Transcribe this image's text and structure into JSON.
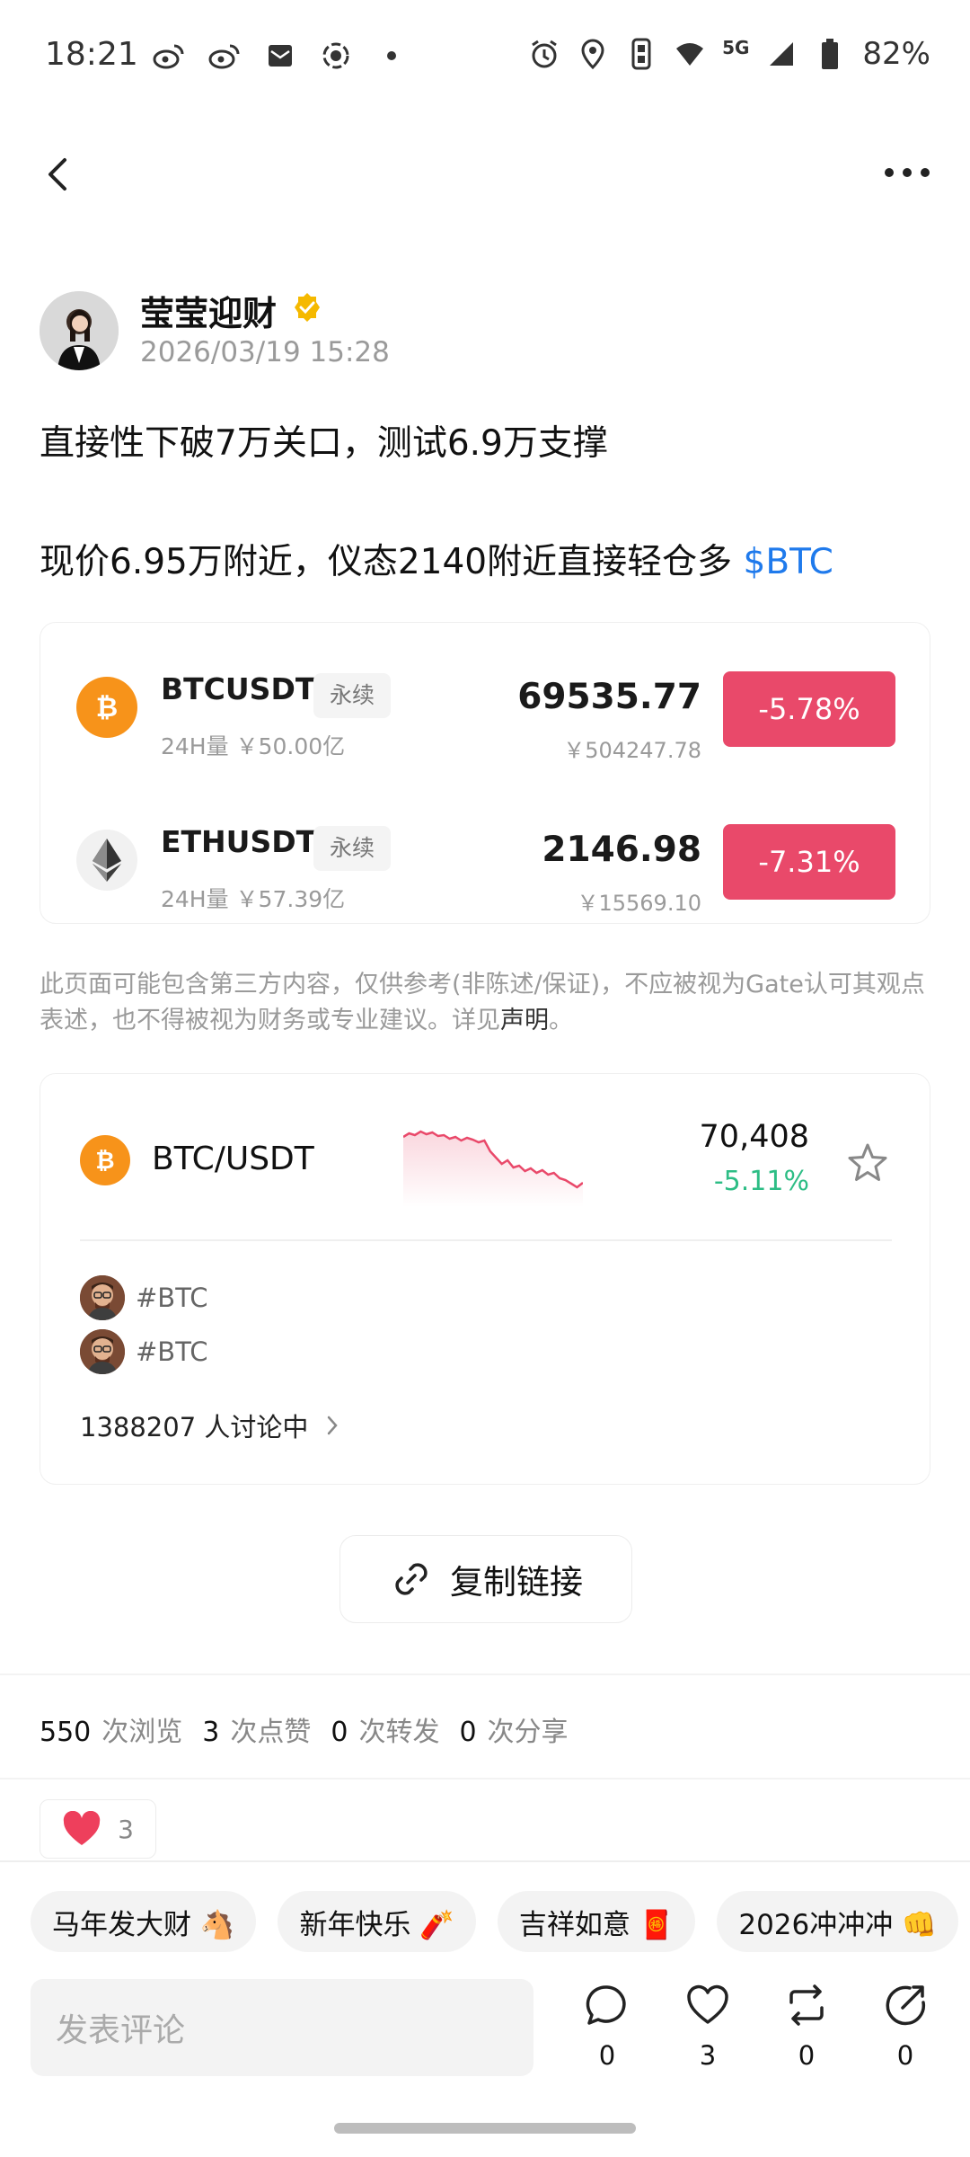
{
  "status_bar": {
    "time": "18:21",
    "battery": "82%",
    "network": "5G",
    "left_icons": [
      "weibo-icon",
      "weibo-icon",
      "mail-icon",
      "target-icon",
      "dot-icon"
    ],
    "right_icons": [
      "alarm-icon",
      "location-icon",
      "vibrate-icon",
      "wifi-icon",
      "signal-icon",
      "battery-icon"
    ]
  },
  "nav": {
    "back_icon": "chevron-left-icon",
    "more_icon": "more-dots-icon"
  },
  "author": {
    "name": "莹莹迎财",
    "time": "2026/03/19 15:28",
    "verified_color": "#f5b900"
  },
  "post": {
    "line1": "直接性下破7万关口，测试6.9万支撑",
    "line2_prefix": "现价6.95万附近，仪态2140附近直接轻仓多 ",
    "cashtag": "$BTC"
  },
  "tickers": [
    {
      "symbol": "BTCUSDT",
      "tag": "永续",
      "volume": "24H量 ￥50.00亿",
      "price": "69535.77",
      "cny": "￥504247.78",
      "change": "-5.78%",
      "icon": "btc-icon"
    },
    {
      "symbol": "ETHUSDT",
      "tag": "永续",
      "volume": "24H量 ￥57.39亿",
      "price": "2146.98",
      "cny": "￥15569.10",
      "change": "-7.31%",
      "icon": "eth-icon"
    }
  ],
  "disclaimer": {
    "text": "此页面可能包含第三方内容，仅供参考(非陈述/保证)，不应被视为Gate认可其观点表述，也不得被视为财务或专业建议。详见",
    "link": "声明",
    "end": "。"
  },
  "market": {
    "pair": "BTC/USDT",
    "price": "70,408",
    "change": "-5.11%",
    "sparkline": [
      0.78,
      0.82,
      0.8,
      0.84,
      0.81,
      0.83,
      0.79,
      0.8,
      0.76,
      0.78,
      0.74,
      0.77,
      0.75,
      0.72,
      0.74,
      0.62,
      0.55,
      0.48,
      0.52,
      0.44,
      0.46,
      0.4,
      0.43,
      0.38,
      0.41,
      0.36,
      0.38,
      0.32,
      0.3,
      0.26,
      0.22,
      0.27
    ],
    "tags": [
      "#BTC",
      "#BTC"
    ],
    "discuss": "1388207 人讨论中"
  },
  "copy_link": "复制链接",
  "stats": [
    {
      "value": "550",
      "label": "次浏览"
    },
    {
      "value": "3",
      "label": "次点赞"
    },
    {
      "value": "0",
      "label": "次转发"
    },
    {
      "value": "0",
      "label": "次分享"
    }
  ],
  "reaction": {
    "icon": "heart-icon",
    "count": "3"
  },
  "chips": [
    "马年发大财 🐴",
    "新年快乐 🧨",
    "吉祥如意 🧧",
    "2026冲冲冲 👊"
  ],
  "comment": {
    "placeholder": "发表评论"
  },
  "actions": [
    {
      "icon": "comment-icon",
      "count": "0"
    },
    {
      "icon": "like-icon",
      "count": "3"
    },
    {
      "icon": "repost-icon",
      "count": "0"
    },
    {
      "icon": "share-icon",
      "count": "0"
    }
  ],
  "colors": {
    "red": "#e9496a",
    "green": "#2dbd85",
    "blue": "#1f7aec",
    "btc": "#f7931a"
  }
}
